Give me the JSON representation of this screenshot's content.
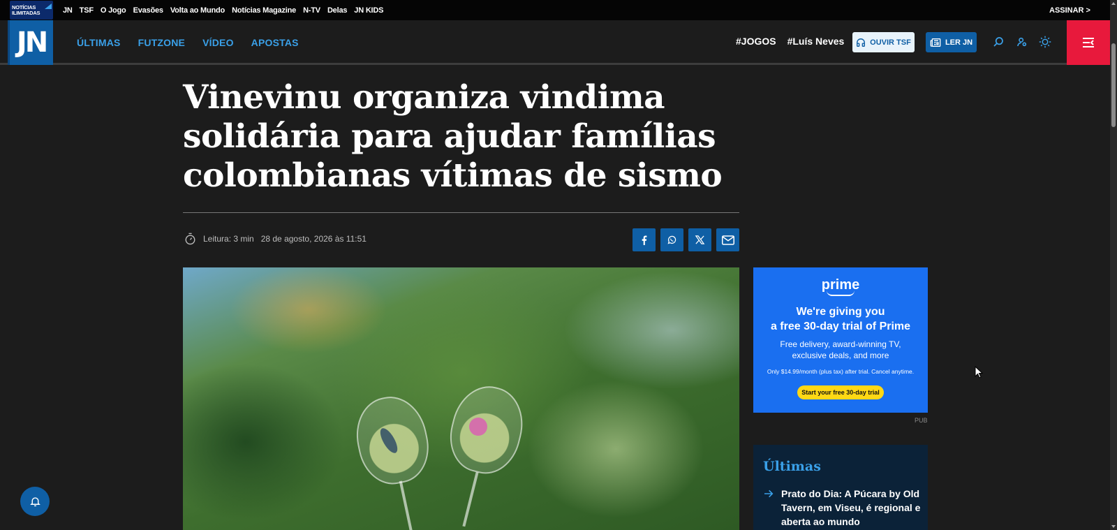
{
  "topbar": {
    "logo_line1": "NOTÍCIAS",
    "logo_line2": "ILIMITADAS",
    "links": [
      "JN",
      "TSF",
      "O Jogo",
      "Evasões",
      "Volta ao Mundo",
      "Notícias Magazine",
      "N-TV",
      "Delas",
      "JN KIDS"
    ],
    "assinar": "ASSINAR >"
  },
  "nav": {
    "logo": "JN",
    "links": [
      "ÚLTIMAS",
      "FUTZONE",
      "VÍDEO",
      "APOSTAS"
    ],
    "tags": [
      "#JOGOS",
      "#Luís Neves"
    ],
    "ouvir_tsf": "OUVIR TSF",
    "ler_jn": "LER JN"
  },
  "article": {
    "title": "Vinevinu organiza vindima solidária para ajudar famílias colombianas vítimas de sismo",
    "reading_time": "Leitura: 3 min",
    "date": "28 de agosto, 2026 às 11:51"
  },
  "ad": {
    "brand": "prime",
    "headline_1": "We're giving you",
    "headline_2": "a free 30-day trial of Prime",
    "sub_1": "Free delivery, award-winning TV,",
    "sub_2": "exclusive deals, and more",
    "terms": "Only $14.99/month (plus tax) after trial. Cancel anytime.",
    "cta": "Start your free 30-day trial",
    "label": "PUB"
  },
  "ultimas": {
    "title": "Últimas",
    "items": [
      "Prato do Dia: A Púcara by Old Tavern, em Viseu, é regional e aberta ao mundo"
    ]
  },
  "colors": {
    "accent": "#0f5fa5",
    "link": "#3aa0e8",
    "menu": "#e8193c"
  }
}
